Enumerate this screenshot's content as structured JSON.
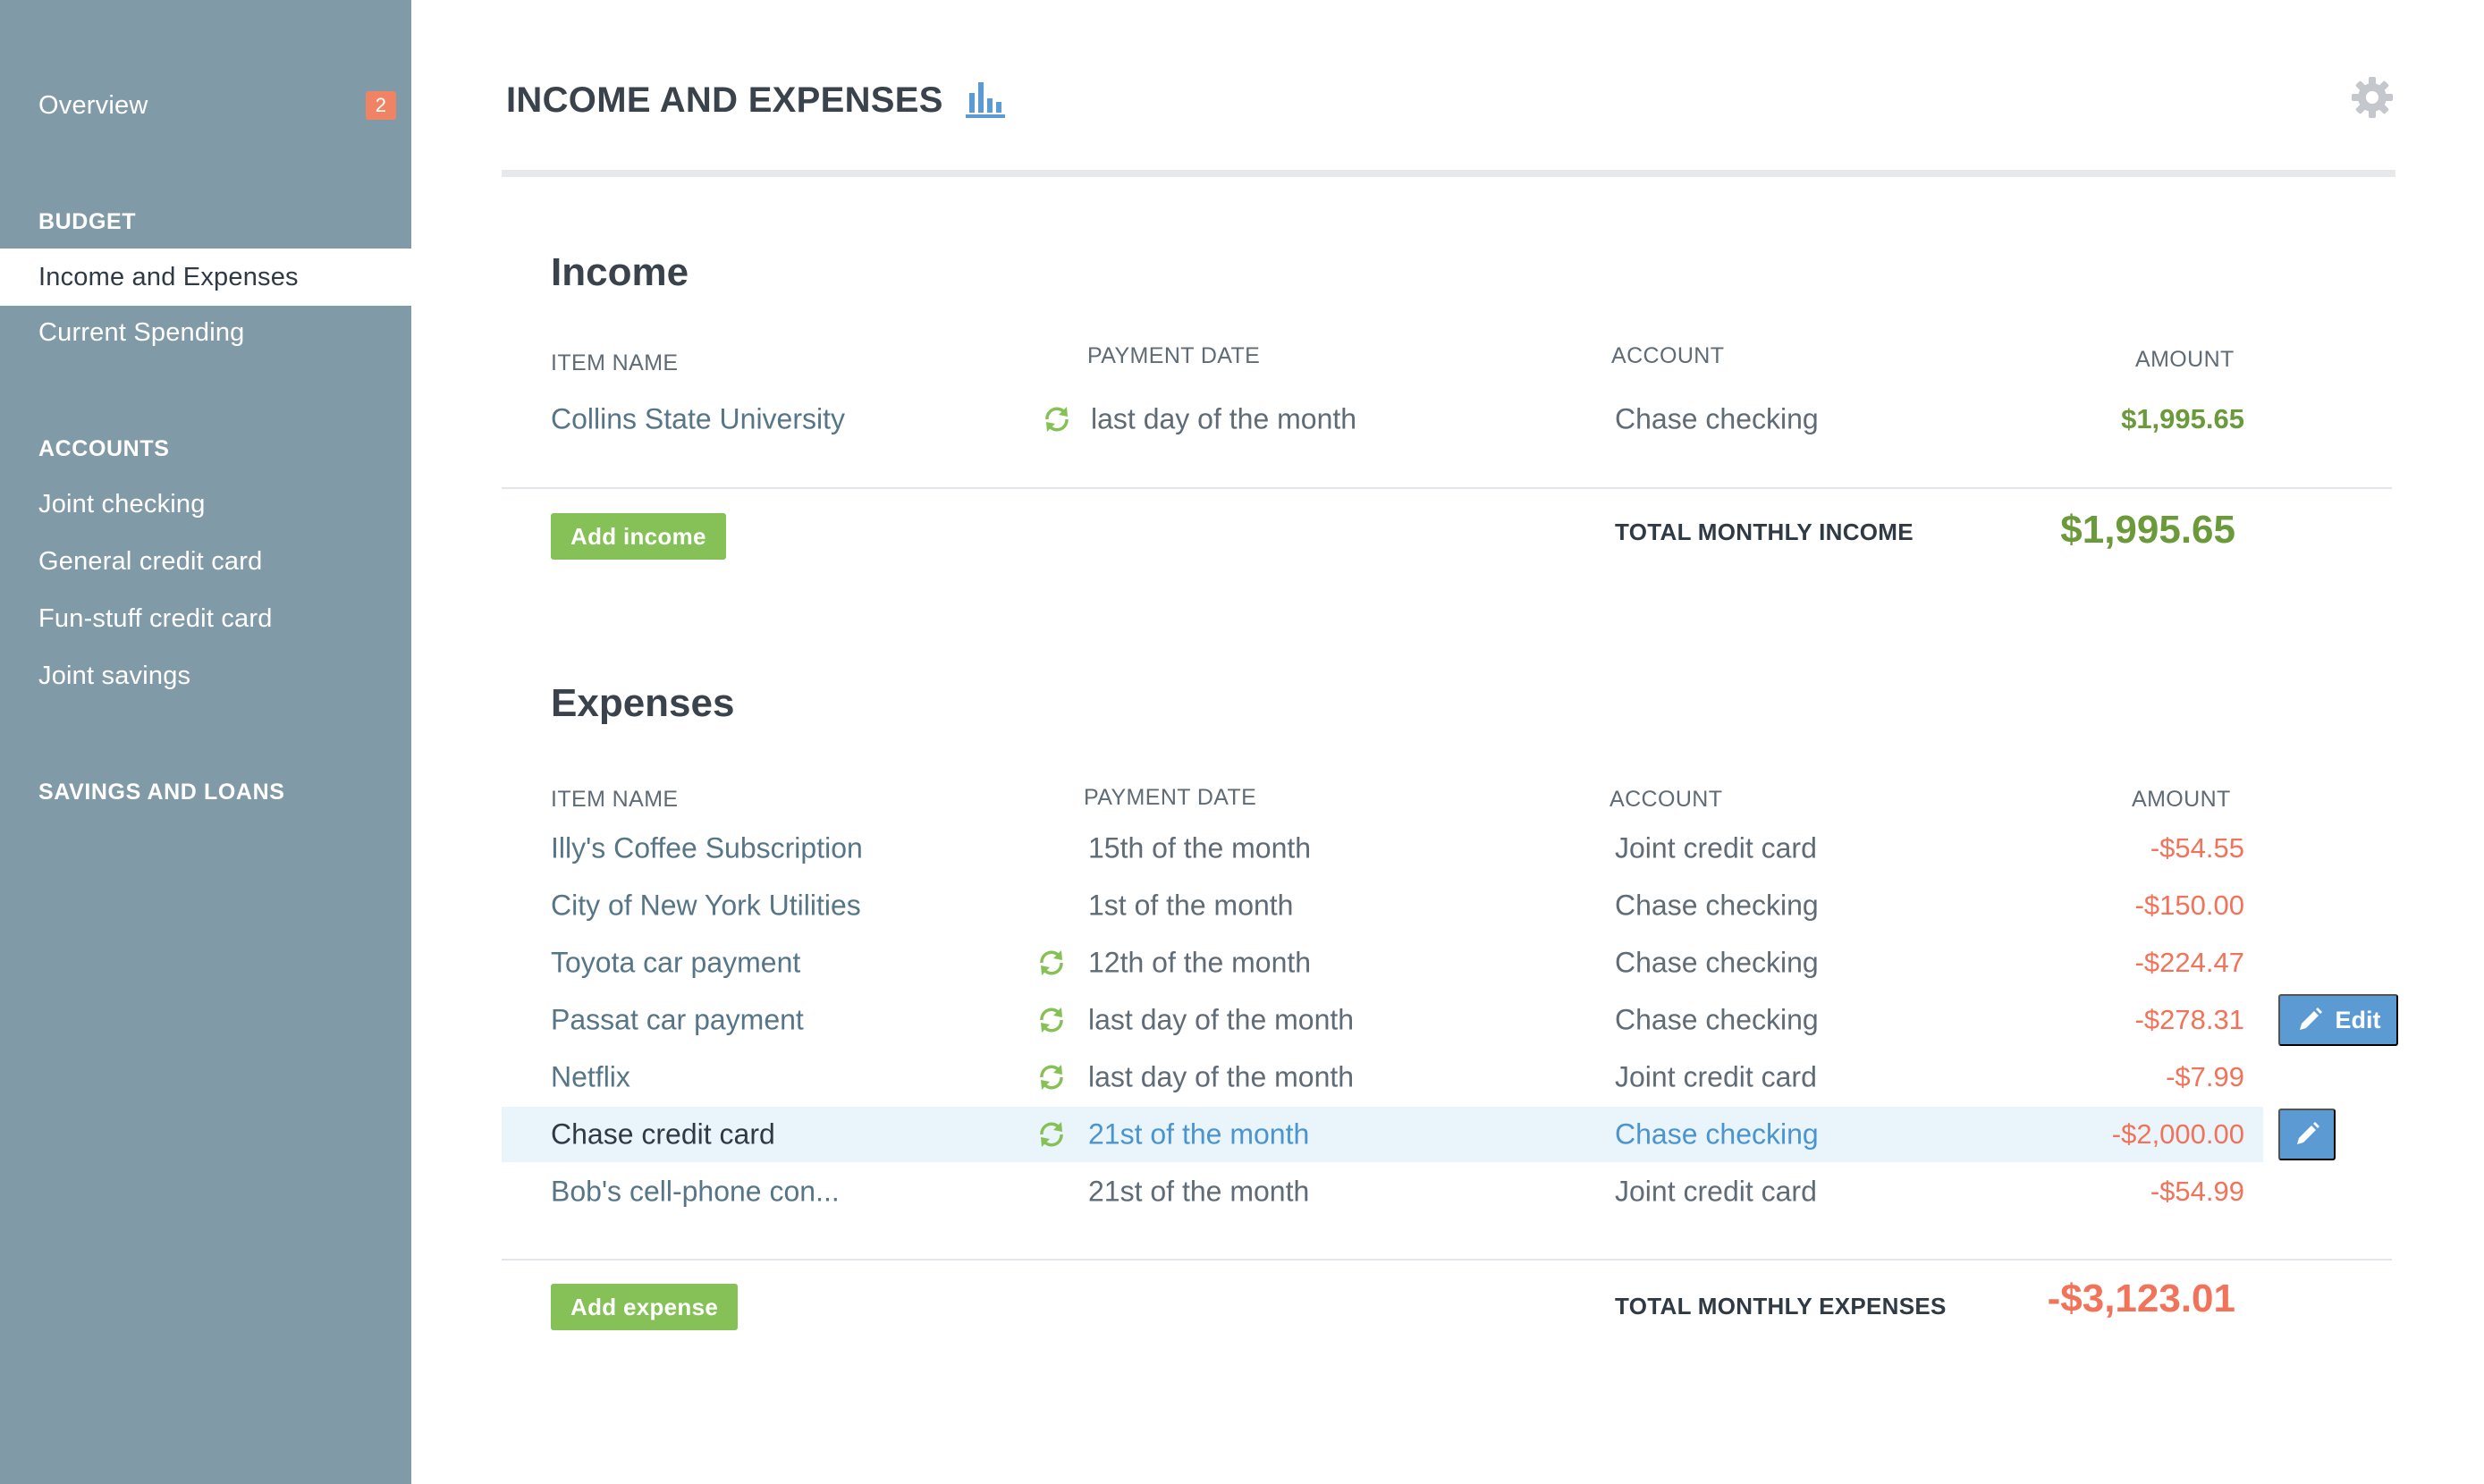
{
  "sidebar": {
    "overview": {
      "label": "Overview",
      "badge": "2"
    },
    "budget_heading": "BUDGET",
    "budget_items": [
      {
        "label": "Income and Expenses",
        "active": true
      },
      {
        "label": "Current Spending",
        "active": false
      }
    ],
    "accounts_heading": "ACCOUNTS",
    "account_items": [
      {
        "label": "Joint checking"
      },
      {
        "label": "General credit card"
      },
      {
        "label": "Fun-stuff credit card"
      },
      {
        "label": "Joint savings"
      }
    ],
    "savings_heading": "SAVINGS AND LOANS"
  },
  "header": {
    "title": "INCOME AND EXPENSES",
    "chart_icon": "bar-chart-icon",
    "settings_icon": "gear-icon"
  },
  "colors": {
    "sidebar_bg": "#809ba7",
    "positive": "#6a9a3a",
    "negative": "#f0735a",
    "button_green": "#86c157",
    "edit_blue": "#5c9ad4",
    "highlight_row": "#eaf4fb",
    "badge": "#f08363"
  },
  "income": {
    "title": "Income",
    "columns": {
      "name": "ITEM NAME",
      "date": "PAYMENT DATE",
      "account": "ACCOUNT",
      "amount": "AMOUNT"
    },
    "rows": [
      {
        "name": "Collins State University",
        "date": "last day of the month",
        "account": "Chase checking",
        "amount": "$1,995.65",
        "recurring": true
      }
    ],
    "add_label": "Add income",
    "total_label": "TOTAL MONTHLY INCOME",
    "total_value": "$1,995.65"
  },
  "expenses": {
    "title": "Expenses",
    "columns": {
      "name": "ITEM NAME",
      "date": "PAYMENT DATE",
      "account": "ACCOUNT",
      "amount": "AMOUNT"
    },
    "rows": [
      {
        "name": "Illy's Coffee Subscription",
        "date": "15th of the month",
        "account": "Joint credit card",
        "amount": "-$54.55",
        "recurring": false
      },
      {
        "name": "City of New York Utilities",
        "date": "1st of the month",
        "account": "Chase checking",
        "amount": "-$150.00",
        "recurring": false
      },
      {
        "name": "Toyota car payment",
        "date": "12th of the month",
        "account": "Chase checking",
        "amount": "-$224.47",
        "recurring": true
      },
      {
        "name": "Passat car payment",
        "date": "last day of the month",
        "account": "Chase checking",
        "amount": "-$278.31",
        "recurring": true
      },
      {
        "name": "Netflix",
        "date": "last day of the month",
        "account": "Joint credit card",
        "amount": "-$7.99",
        "recurring": true
      },
      {
        "name": "Chase credit card",
        "date": "21st of the month",
        "account": "Chase checking",
        "amount": "-$2,000.00",
        "recurring": true
      },
      {
        "name": "Bob's cell-phone con...",
        "date": "21st of the month",
        "account": "Joint credit card",
        "amount": "-$54.99",
        "recurring": false
      }
    ],
    "edit_label": "Edit",
    "add_label": "Add expense",
    "total_label": "TOTAL MONTHLY EXPENSES",
    "total_value": "-$3,123.01"
  }
}
